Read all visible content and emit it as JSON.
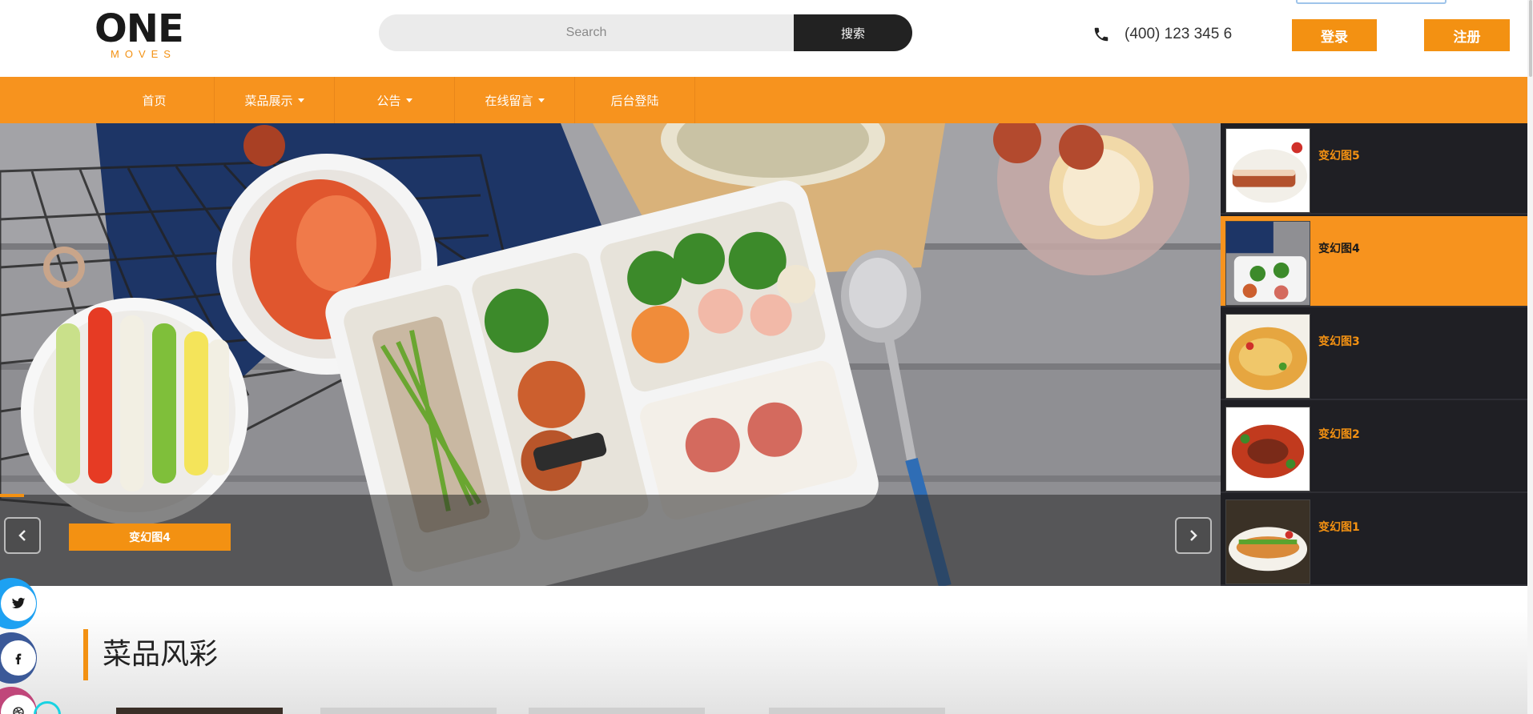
{
  "header": {
    "logo_main": "ONE",
    "logo_sub": "MOVES",
    "search": {
      "placeholder": "Search",
      "button_label": "搜索"
    },
    "phone": "(400) 123 345 6",
    "login_label": "登录",
    "register_label": "注册"
  },
  "nav": {
    "items": [
      {
        "label": "首页",
        "has_dropdown": false
      },
      {
        "label": "菜品展示",
        "has_dropdown": true
      },
      {
        "label": "公告",
        "has_dropdown": true
      },
      {
        "label": "在线留言",
        "has_dropdown": true
      },
      {
        "label": "后台登陆",
        "has_dropdown": false
      }
    ]
  },
  "slider": {
    "caption": "变幻图4",
    "thumbnails": [
      {
        "title": "变幻图5",
        "active": false
      },
      {
        "title": "变幻图4",
        "active": true
      },
      {
        "title": "变幻图3",
        "active": false
      },
      {
        "title": "变幻图2",
        "active": false
      },
      {
        "title": "变幻图1",
        "active": false
      }
    ]
  },
  "social": {
    "icons": [
      "twitter-icon",
      "facebook-icon",
      "dribbble-icon"
    ]
  },
  "section": {
    "title": "菜品风彩"
  },
  "colors": {
    "accent": "#f39112",
    "nav_bg": "#f7931e",
    "dark": "#222222",
    "thumb_panel": "#1f1f24"
  }
}
